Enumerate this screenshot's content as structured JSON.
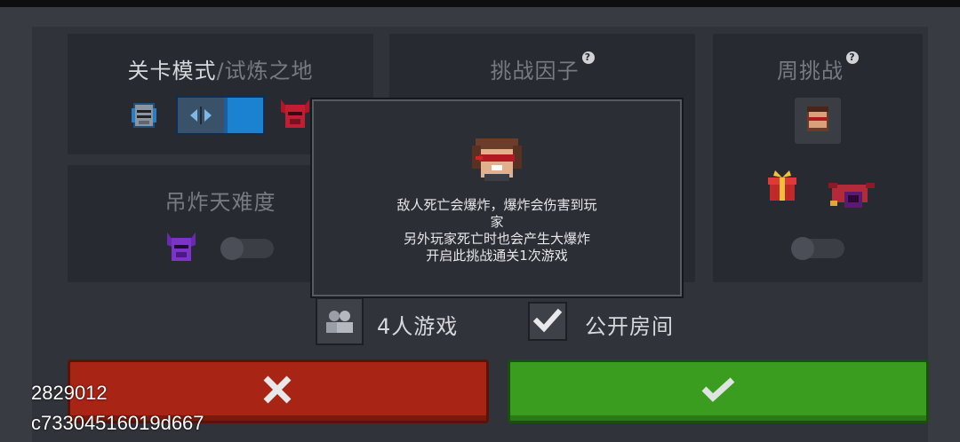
{
  "panels": {
    "mode": {
      "title_main": "关卡模式",
      "title_separator": "/",
      "title_sub": "试炼之地"
    },
    "factor": {
      "title": "挑战因子",
      "help": "?"
    },
    "weekly": {
      "title": "周挑战",
      "help": "?"
    },
    "difficulty": {
      "title": "吊炸天难度"
    }
  },
  "dialog": {
    "lines": [
      "敌人死亡会爆炸，爆炸会伤害到玩",
      "家",
      "另外玩家死亡时也会产生大爆炸",
      "开启此挑战通关1次游戏"
    ]
  },
  "options": {
    "players_label": "4人游戏",
    "public_room_label": "公开房间",
    "public_room_checked": true
  },
  "buttons": {
    "cancel_icon": "close-icon",
    "confirm_icon": "check-icon"
  },
  "overlay": {
    "line1": "2829012",
    "line2": "c73304516019d667"
  },
  "colors": {
    "cancel": "#a82415",
    "confirm": "#3a9d1f",
    "dialog_bg": "#2b2e34",
    "panel_bg": "#272a30"
  }
}
